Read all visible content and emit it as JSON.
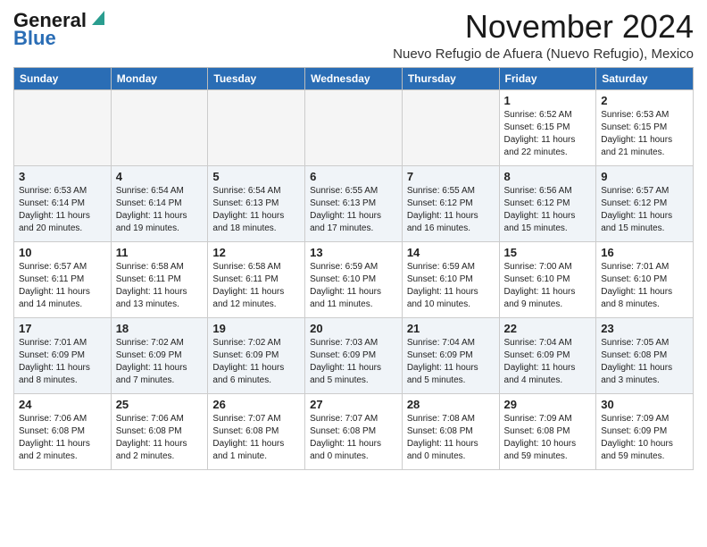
{
  "logo": {
    "general": "General",
    "blue": "Blue"
  },
  "title": "November 2024",
  "location": "Nuevo Refugio de Afuera (Nuevo Refugio), Mexico",
  "days_of_week": [
    "Sunday",
    "Monday",
    "Tuesday",
    "Wednesday",
    "Thursday",
    "Friday",
    "Saturday"
  ],
  "weeks": [
    {
      "shade": false,
      "days": [
        {
          "date": "",
          "empty": true
        },
        {
          "date": "",
          "empty": true
        },
        {
          "date": "",
          "empty": true
        },
        {
          "date": "",
          "empty": true
        },
        {
          "date": "",
          "empty": true
        },
        {
          "date": "1",
          "empty": false,
          "sunrise": "Sunrise: 6:52 AM",
          "sunset": "Sunset: 6:15 PM",
          "daylight": "Daylight: 11 hours and 22 minutes."
        },
        {
          "date": "2",
          "empty": false,
          "sunrise": "Sunrise: 6:53 AM",
          "sunset": "Sunset: 6:15 PM",
          "daylight": "Daylight: 11 hours and 21 minutes."
        }
      ]
    },
    {
      "shade": true,
      "days": [
        {
          "date": "3",
          "empty": false,
          "sunrise": "Sunrise: 6:53 AM",
          "sunset": "Sunset: 6:14 PM",
          "daylight": "Daylight: 11 hours and 20 minutes."
        },
        {
          "date": "4",
          "empty": false,
          "sunrise": "Sunrise: 6:54 AM",
          "sunset": "Sunset: 6:14 PM",
          "daylight": "Daylight: 11 hours and 19 minutes."
        },
        {
          "date": "5",
          "empty": false,
          "sunrise": "Sunrise: 6:54 AM",
          "sunset": "Sunset: 6:13 PM",
          "daylight": "Daylight: 11 hours and 18 minutes."
        },
        {
          "date": "6",
          "empty": false,
          "sunrise": "Sunrise: 6:55 AM",
          "sunset": "Sunset: 6:13 PM",
          "daylight": "Daylight: 11 hours and 17 minutes."
        },
        {
          "date": "7",
          "empty": false,
          "sunrise": "Sunrise: 6:55 AM",
          "sunset": "Sunset: 6:12 PM",
          "daylight": "Daylight: 11 hours and 16 minutes."
        },
        {
          "date": "8",
          "empty": false,
          "sunrise": "Sunrise: 6:56 AM",
          "sunset": "Sunset: 6:12 PM",
          "daylight": "Daylight: 11 hours and 15 minutes."
        },
        {
          "date": "9",
          "empty": false,
          "sunrise": "Sunrise: 6:57 AM",
          "sunset": "Sunset: 6:12 PM",
          "daylight": "Daylight: 11 hours and 15 minutes."
        }
      ]
    },
    {
      "shade": false,
      "days": [
        {
          "date": "10",
          "empty": false,
          "sunrise": "Sunrise: 6:57 AM",
          "sunset": "Sunset: 6:11 PM",
          "daylight": "Daylight: 11 hours and 14 minutes."
        },
        {
          "date": "11",
          "empty": false,
          "sunrise": "Sunrise: 6:58 AM",
          "sunset": "Sunset: 6:11 PM",
          "daylight": "Daylight: 11 hours and 13 minutes."
        },
        {
          "date": "12",
          "empty": false,
          "sunrise": "Sunrise: 6:58 AM",
          "sunset": "Sunset: 6:11 PM",
          "daylight": "Daylight: 11 hours and 12 minutes."
        },
        {
          "date": "13",
          "empty": false,
          "sunrise": "Sunrise: 6:59 AM",
          "sunset": "Sunset: 6:10 PM",
          "daylight": "Daylight: 11 hours and 11 minutes."
        },
        {
          "date": "14",
          "empty": false,
          "sunrise": "Sunrise: 6:59 AM",
          "sunset": "Sunset: 6:10 PM",
          "daylight": "Daylight: 11 hours and 10 minutes."
        },
        {
          "date": "15",
          "empty": false,
          "sunrise": "Sunrise: 7:00 AM",
          "sunset": "Sunset: 6:10 PM",
          "daylight": "Daylight: 11 hours and 9 minutes."
        },
        {
          "date": "16",
          "empty": false,
          "sunrise": "Sunrise: 7:01 AM",
          "sunset": "Sunset: 6:10 PM",
          "daylight": "Daylight: 11 hours and 8 minutes."
        }
      ]
    },
    {
      "shade": true,
      "days": [
        {
          "date": "17",
          "empty": false,
          "sunrise": "Sunrise: 7:01 AM",
          "sunset": "Sunset: 6:09 PM",
          "daylight": "Daylight: 11 hours and 8 minutes."
        },
        {
          "date": "18",
          "empty": false,
          "sunrise": "Sunrise: 7:02 AM",
          "sunset": "Sunset: 6:09 PM",
          "daylight": "Daylight: 11 hours and 7 minutes."
        },
        {
          "date": "19",
          "empty": false,
          "sunrise": "Sunrise: 7:02 AM",
          "sunset": "Sunset: 6:09 PM",
          "daylight": "Daylight: 11 hours and 6 minutes."
        },
        {
          "date": "20",
          "empty": false,
          "sunrise": "Sunrise: 7:03 AM",
          "sunset": "Sunset: 6:09 PM",
          "daylight": "Daylight: 11 hours and 5 minutes."
        },
        {
          "date": "21",
          "empty": false,
          "sunrise": "Sunrise: 7:04 AM",
          "sunset": "Sunset: 6:09 PM",
          "daylight": "Daylight: 11 hours and 5 minutes."
        },
        {
          "date": "22",
          "empty": false,
          "sunrise": "Sunrise: 7:04 AM",
          "sunset": "Sunset: 6:09 PM",
          "daylight": "Daylight: 11 hours and 4 minutes."
        },
        {
          "date": "23",
          "empty": false,
          "sunrise": "Sunrise: 7:05 AM",
          "sunset": "Sunset: 6:08 PM",
          "daylight": "Daylight: 11 hours and 3 minutes."
        }
      ]
    },
    {
      "shade": false,
      "days": [
        {
          "date": "24",
          "empty": false,
          "sunrise": "Sunrise: 7:06 AM",
          "sunset": "Sunset: 6:08 PM",
          "daylight": "Daylight: 11 hours and 2 minutes."
        },
        {
          "date": "25",
          "empty": false,
          "sunrise": "Sunrise: 7:06 AM",
          "sunset": "Sunset: 6:08 PM",
          "daylight": "Daylight: 11 hours and 2 minutes."
        },
        {
          "date": "26",
          "empty": false,
          "sunrise": "Sunrise: 7:07 AM",
          "sunset": "Sunset: 6:08 PM",
          "daylight": "Daylight: 11 hours and 1 minute."
        },
        {
          "date": "27",
          "empty": false,
          "sunrise": "Sunrise: 7:07 AM",
          "sunset": "Sunset: 6:08 PM",
          "daylight": "Daylight: 11 hours and 0 minutes."
        },
        {
          "date": "28",
          "empty": false,
          "sunrise": "Sunrise: 7:08 AM",
          "sunset": "Sunset: 6:08 PM",
          "daylight": "Daylight: 11 hours and 0 minutes."
        },
        {
          "date": "29",
          "empty": false,
          "sunrise": "Sunrise: 7:09 AM",
          "sunset": "Sunset: 6:08 PM",
          "daylight": "Daylight: 10 hours and 59 minutes."
        },
        {
          "date": "30",
          "empty": false,
          "sunrise": "Sunrise: 7:09 AM",
          "sunset": "Sunset: 6:09 PM",
          "daylight": "Daylight: 10 hours and 59 minutes."
        }
      ]
    }
  ]
}
